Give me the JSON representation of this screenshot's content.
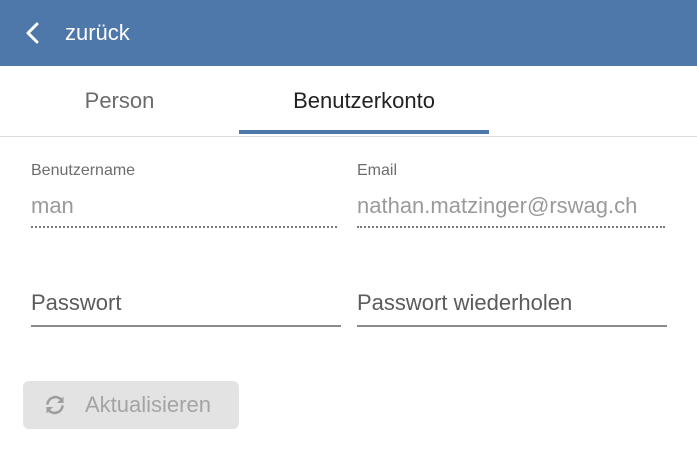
{
  "header": {
    "back_label": "zurück",
    "background_color": "#4f78aa"
  },
  "tabs": [
    {
      "label": "Person",
      "active": false
    },
    {
      "label": "Benutzerkonto",
      "active": true
    }
  ],
  "form": {
    "username": {
      "label": "Benutzername",
      "value": "man"
    },
    "email": {
      "label": "Email",
      "value": "nathan.matzinger@rswag.ch"
    },
    "password": {
      "placeholder": "Passwort"
    },
    "password_repeat": {
      "placeholder": "Passwort wiederholen"
    }
  },
  "update_button": {
    "label": "Aktualisieren",
    "icon": "refresh-icon",
    "disabled": true
  }
}
